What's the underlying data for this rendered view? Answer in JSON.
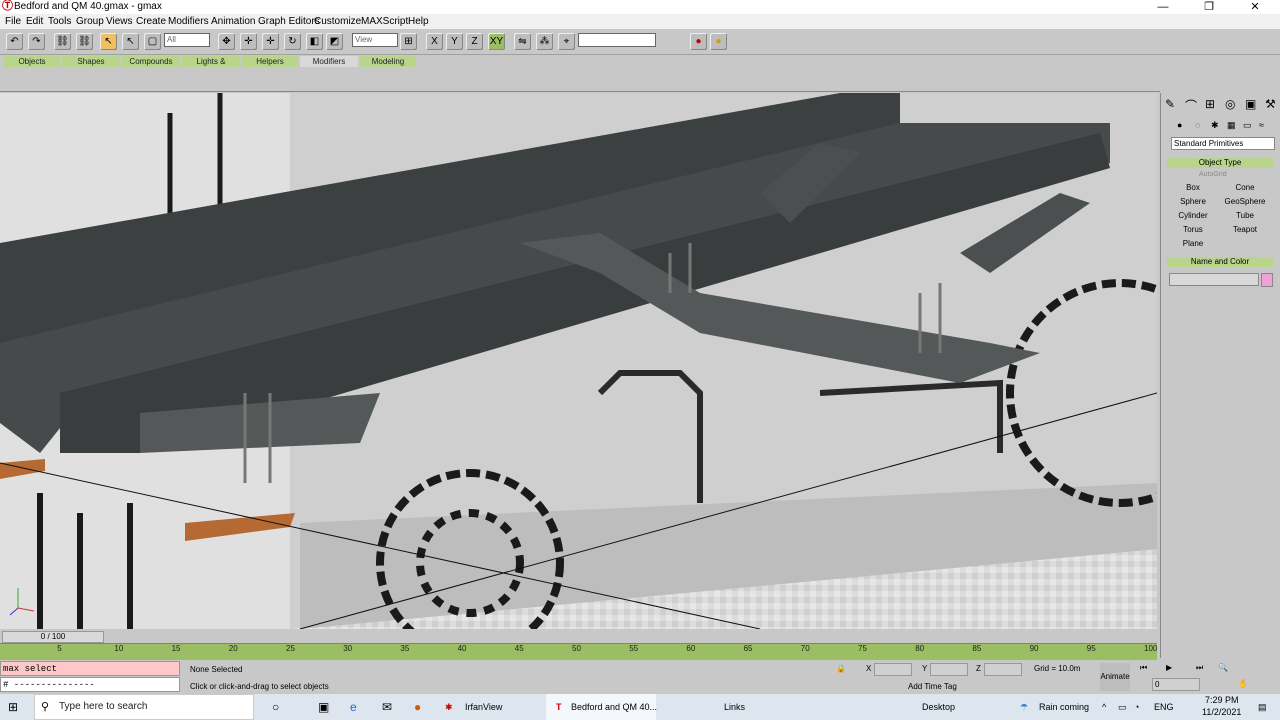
{
  "window": {
    "title": "Bedford and QM 40.gmax - gmax"
  },
  "menu": [
    "File",
    "Edit",
    "Tools",
    "Group",
    "Views",
    "Create",
    "Modifiers",
    "Animation",
    "Graph Editors",
    "Customize",
    "MAXScript",
    "Help"
  ],
  "toolbar": {
    "selection_filter": "All",
    "reference_coord": "View",
    "named_selection": ""
  },
  "tabs": [
    "Objects",
    "Shapes",
    "Compounds",
    "Lights & Cameras",
    "Helpers",
    "Modifiers",
    "Modeling"
  ],
  "command_panel": {
    "category_dropdown": "Standard Primitives",
    "object_type_title": "Object Type",
    "autogrid_label": "AutoGrid",
    "buttons": [
      "Box",
      "Cone",
      "Sphere",
      "GeoSphere",
      "Cylinder",
      "Tube",
      "Torus",
      "Teapot",
      "Plane"
    ],
    "name_color_title": "Name and Color",
    "name_value": "",
    "color": "#f0a0d8"
  },
  "timeline": {
    "slider_label": "0 / 100",
    "ticks": [
      "5",
      "10",
      "15",
      "20",
      "25",
      "30",
      "35",
      "40",
      "45",
      "50",
      "55",
      "60",
      "65",
      "70",
      "75",
      "80",
      "85",
      "90",
      "95",
      "100"
    ]
  },
  "status": {
    "listener_line1": "max select",
    "listener_line2": "# ---------------",
    "selection_status": "None Selected",
    "prompt": "Click or click-and-drag to select objects",
    "x_label": "X",
    "y_label": "Y",
    "z_label": "Z",
    "grid": "Grid = 10.0m",
    "add_time_tag": "Add Time Tag",
    "animate": "Animate",
    "frame": "0"
  },
  "taskbar": {
    "search_placeholder": "Type here to search",
    "apps": [
      "IrfanView",
      "Bedford and QM 40...",
      "Links"
    ],
    "desktop": "Desktop",
    "weather": "Rain coming",
    "language": "ENG",
    "time": "7:29 PM",
    "date": "11/2/2021"
  },
  "colors": {
    "tab_green": "#b9d58c",
    "track_green": "#9bbd63",
    "accent_orange": "#f0c060"
  }
}
